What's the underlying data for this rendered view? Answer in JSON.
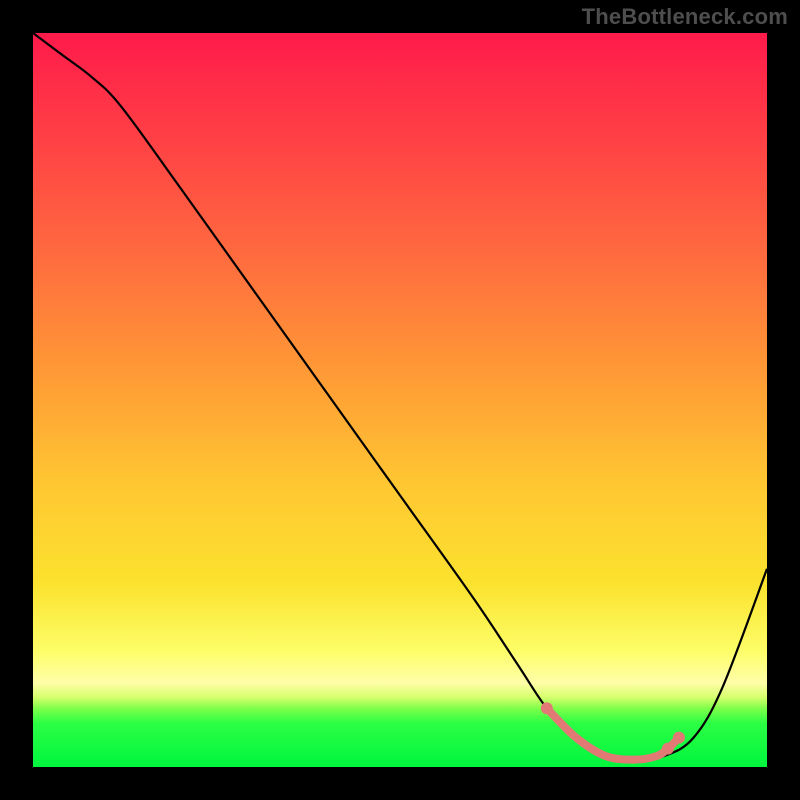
{
  "watermark": "TheBottleneck.com",
  "colors": {
    "curve": "#000000",
    "highlight": "#e17a75",
    "frame": "#000000"
  },
  "chart_data": {
    "type": "line",
    "title": "",
    "xlabel": "",
    "ylabel": "",
    "xlim": [
      0,
      100
    ],
    "ylim": [
      0,
      100
    ],
    "grid": false,
    "series": [
      {
        "name": "bottleneck-curve",
        "x": [
          0,
          4,
          8,
          12,
          20,
          30,
          40,
          50,
          60,
          66,
          70,
          74,
          78,
          82,
          86,
          90,
          94,
          100
        ],
        "y": [
          100,
          97,
          94,
          90,
          79,
          65,
          51,
          37,
          23,
          14,
          8,
          4,
          1.5,
          1,
          1.5,
          4,
          11,
          27
        ],
        "color": "#000000"
      }
    ],
    "highlight": {
      "x_range": [
        70,
        86
      ],
      "points_x": [
        70,
        74,
        78,
        82,
        85,
        86.5,
        88
      ],
      "points_y": [
        8,
        4,
        1.5,
        1,
        1.5,
        2.5,
        4
      ],
      "color": "#e17a75"
    }
  }
}
